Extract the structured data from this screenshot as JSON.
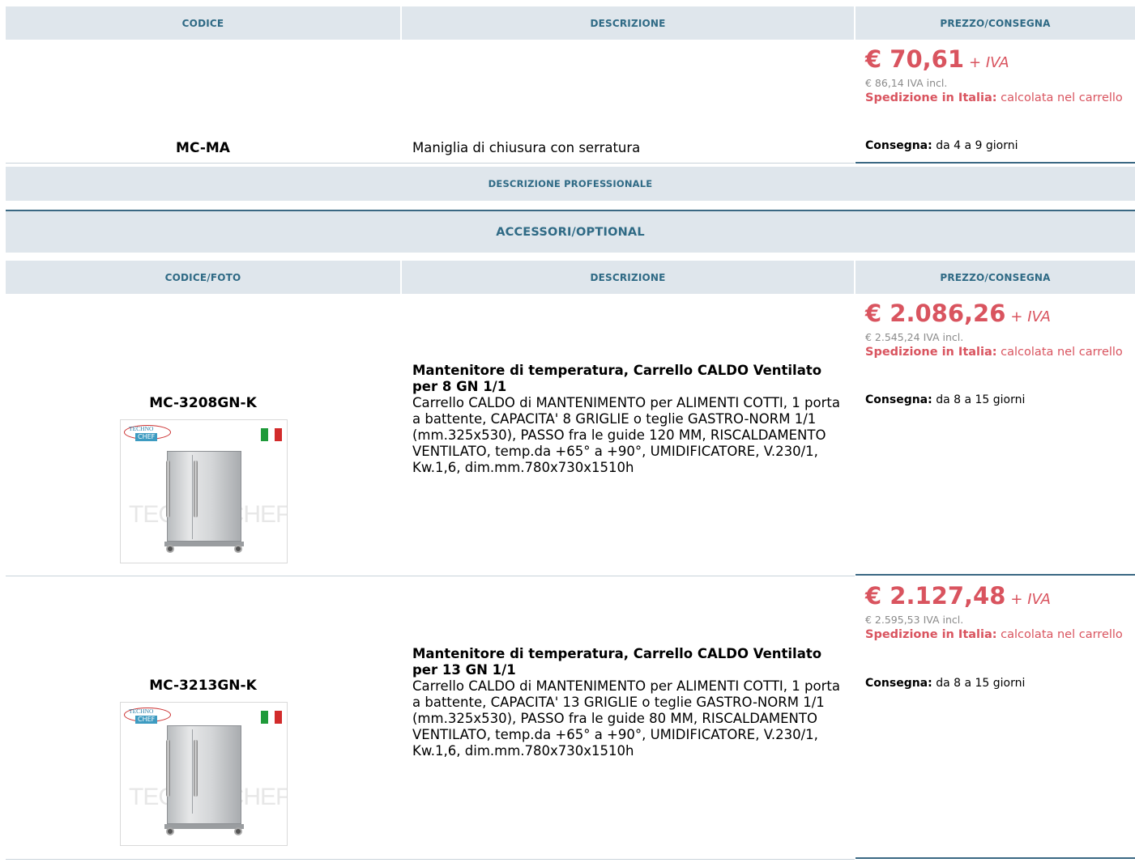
{
  "main_table": {
    "headers": [
      "CODICE",
      "DESCRIZIONE",
      "PREZZO/CONSEGNA"
    ],
    "row": {
      "code": "MC-MA",
      "description": "Maniglia di chiusura con serratura",
      "price": "€ 70,61",
      "price_suffix": "+ IVA",
      "price_incl": "€ 86,14 IVA incl.",
      "shipping_label": "Spedizione in Italia:",
      "shipping_value": "calcolata nel carrello",
      "delivery_label": "Consegna:",
      "delivery_value": "da 4 a 9 giorni"
    }
  },
  "professional_description_label": "DESCRIZIONE PROFESSIONALE",
  "accessories": {
    "title": "ACCESSORI/OPTIONAL",
    "headers": [
      "CODICE/FOTO",
      "DESCRIZIONE",
      "PREZZO/CONSEGNA"
    ],
    "items": [
      {
        "code": "MC-3208GN-K",
        "title": "Mantenitore di temperatura, Carrello CALDO Ventilato per 8 GN 1/1",
        "description": "Carrello CALDO di MANTENIMENTO per ALIMENTI COTTI, 1 porta a battente, CAPACITA' 8 GRIGLIE o teglie GASTRO-NORM 1/1 (mm.325x530), PASSO fra le guide 120 MM, RISCALDAMENTO VENTILATO, temp.da +65° a +90°, UMIDIFICATORE, V.230/1, Kw.1,6, dim.mm.780x730x1510h",
        "price": "€ 2.086,26",
        "price_suffix": "+ IVA",
        "price_incl": "€ 2.545,24 IVA incl.",
        "shipping_label": "Spedizione in Italia:",
        "shipping_value": "calcolata nel carrello",
        "delivery_label": "Consegna:",
        "delivery_value": "da 8 a 15 giorni",
        "logo_line1": "TECHNO",
        "logo_line2": "CHEF",
        "watermark": "TECHNOCHEF.IT"
      },
      {
        "code": "MC-3213GN-K",
        "title": "Mantenitore di temperatura, Carrello CALDO Ventilato per 13 GN 1/1",
        "description": "Carrello CALDO di MANTENIMENTO per ALIMENTI COTTI, 1 porta a battente, CAPACITA' 13 GRIGLIE o teglie GASTRO-NORM 1/1 (mm.325x530), PASSO fra le guide 80 MM, RISCALDAMENTO VENTILATO, temp.da +65° a +90°, UMIDIFICATORE, V.230/1, Kw.1,6, dim.mm.780x730x1510h",
        "price": "€ 2.127,48",
        "price_suffix": "+ IVA",
        "price_incl": "€ 2.595,53 IVA incl.",
        "shipping_label": "Spedizione in Italia:",
        "shipping_value": "calcolata nel carrello",
        "delivery_label": "Consegna:",
        "delivery_value": "da 8 a 15 giorni",
        "logo_line1": "TECHNO",
        "logo_line2": "CHEF",
        "watermark": "TECHNOCHEF.IT"
      }
    ]
  },
  "colors": {
    "header_bg": "#dfe6ec",
    "header_text": "#2f6a85",
    "price": "#d9545f",
    "divider": "#3a6883"
  }
}
